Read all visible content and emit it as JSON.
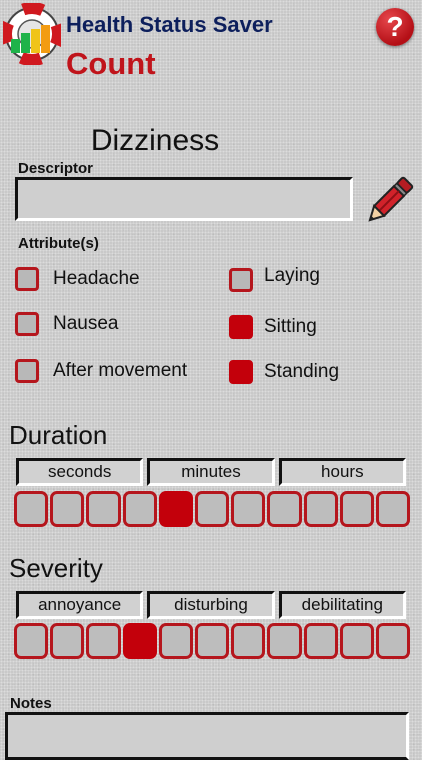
{
  "header": {
    "app_title": "Health Status Saver",
    "screen_title": "Count",
    "help_label": "?",
    "logo_icon": "life-ring-bar-chart-icon"
  },
  "symptom": {
    "name": "Dizziness"
  },
  "descriptor": {
    "label": "Descriptor",
    "value": "",
    "edit_icon": "pencil-icon"
  },
  "attributes": {
    "label": "Attribute(s)",
    "items": [
      {
        "label": "Headache",
        "checked": false
      },
      {
        "label": "Laying",
        "checked": false
      },
      {
        "label": "Nausea",
        "checked": false
      },
      {
        "label": "Sitting",
        "checked": true
      },
      {
        "label": "After movement",
        "checked": false
      },
      {
        "label": "Standing",
        "checked": true
      }
    ]
  },
  "duration": {
    "title": "Duration",
    "tabs": [
      "seconds",
      "minutes",
      "hours"
    ],
    "scale_count": 11,
    "selected_index": 4
  },
  "severity": {
    "title": "Severity",
    "tabs": [
      "annoyance",
      "disturbing",
      "debilitating"
    ],
    "scale_count": 11,
    "selected_index": 3
  },
  "notes": {
    "label": "Notes",
    "value": ""
  },
  "colors": {
    "accent": "#c3000b",
    "title_blue": "#0d1f5c",
    "title_red": "#c0141b",
    "background": "#c9c9c9"
  }
}
